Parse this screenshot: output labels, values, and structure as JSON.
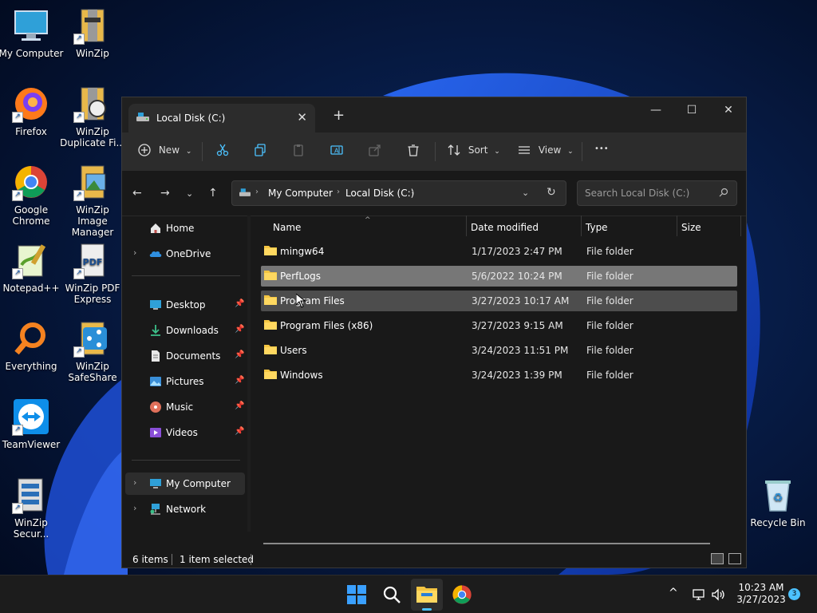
{
  "desktop": {
    "icons": [
      {
        "label": "My Computer"
      },
      {
        "label": "WinZip"
      },
      {
        "label": "Firefox"
      },
      {
        "label": "WinZip Duplicate Fi..."
      },
      {
        "label": "Google Chrome"
      },
      {
        "label": "WinZip Image Manager"
      },
      {
        "label": "Notepad++"
      },
      {
        "label": "WinZip PDF Express"
      },
      {
        "label": "Everything"
      },
      {
        "label": "WinZip SafeShare"
      },
      {
        "label": "TeamViewer"
      },
      {
        "label": "WinZip Secur..."
      },
      {
        "label": "Recycle Bin"
      }
    ]
  },
  "window": {
    "tab_title": "Local Disk (C:)",
    "new_tab": "+",
    "controls": {
      "minimize": "—",
      "maximize": "☐",
      "close": "✕"
    },
    "toolbar": {
      "new_label": "New",
      "sort_label": "Sort",
      "view_label": "View",
      "more_label": "•••"
    },
    "address": {
      "crumbs": [
        "My Computer",
        "Local Disk (C:)"
      ],
      "search_placeholder": "Search Local Disk (C:)"
    },
    "nav": {
      "items": [
        {
          "label": "Home"
        },
        {
          "label": "OneDrive"
        },
        {
          "label": "Desktop"
        },
        {
          "label": "Downloads"
        },
        {
          "label": "Documents"
        },
        {
          "label": "Pictures"
        },
        {
          "label": "Music"
        },
        {
          "label": "Videos"
        },
        {
          "label": "My Computer"
        },
        {
          "label": "Network"
        }
      ]
    },
    "columns": {
      "name": "Name",
      "date": "Date modified",
      "type": "Type",
      "size": "Size"
    },
    "files": [
      {
        "name": "mingw64",
        "date": "1/17/2023 2:47 PM",
        "type": "File folder"
      },
      {
        "name": "PerfLogs",
        "date": "5/6/2022 10:24 PM",
        "type": "File folder"
      },
      {
        "name": "Program Files",
        "date": "3/27/2023 10:17 AM",
        "type": "File folder"
      },
      {
        "name": "Program Files (x86)",
        "date": "3/27/2023 9:15 AM",
        "type": "File folder"
      },
      {
        "name": "Users",
        "date": "3/24/2023 11:51 PM",
        "type": "File folder"
      },
      {
        "name": "Windows",
        "date": "3/24/2023 1:39 PM",
        "type": "File folder"
      }
    ],
    "status": {
      "count": "6 items",
      "selected": "1 item selected"
    }
  },
  "taskbar": {
    "time": "10:23 AM",
    "date": "3/27/2023",
    "notifications": "3",
    "tray_chevron": "^"
  },
  "colors": {
    "accent": "#4cc2ff",
    "folder": "#f4c542",
    "selection": "#777777"
  }
}
